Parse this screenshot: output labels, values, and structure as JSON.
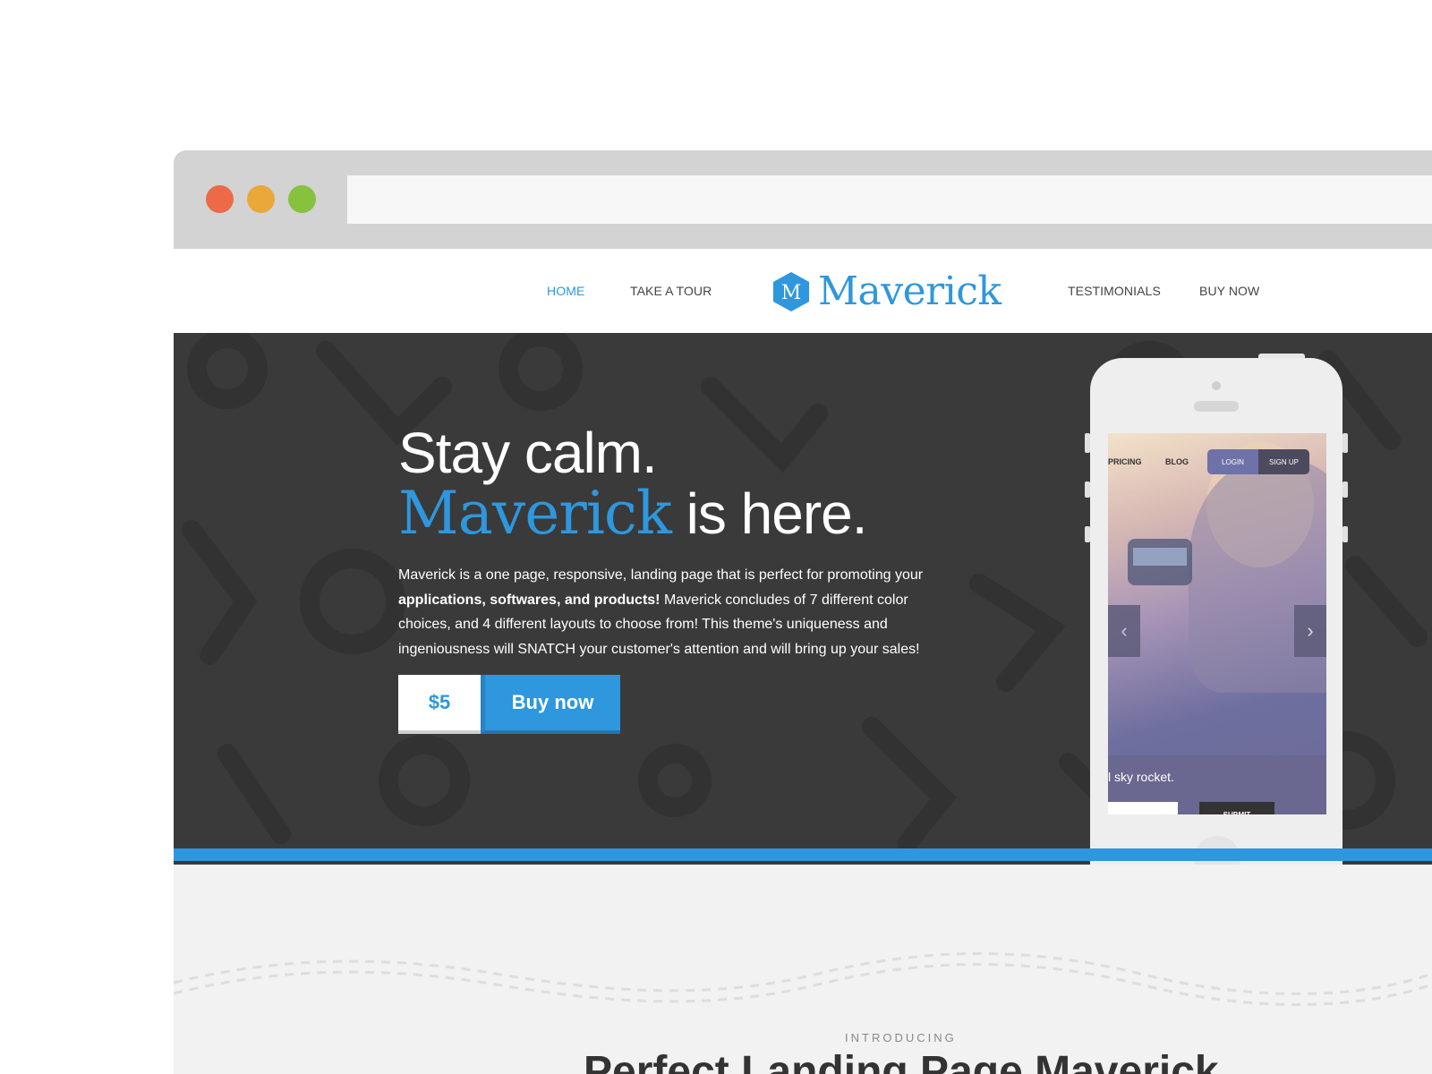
{
  "window": {
    "controls": [
      "close",
      "minimize",
      "maximize"
    ],
    "colors": {
      "close": "#ec6a47",
      "minimize": "#e9a83a",
      "maximize": "#86c23d"
    }
  },
  "nav": {
    "home": "HOME",
    "tour": "TAKE A TOUR",
    "testimonials": "TESTIMONIALS",
    "buy": "BUY NOW",
    "logo_letter": "M",
    "logo_text": "Maverick"
  },
  "hero": {
    "line1": "Stay calm.",
    "brand": "Maverick",
    "line2_rest": " is here.",
    "desc_part1": "Maverick is a one page, responsive, landing page that is perfect for promoting your ",
    "desc_bold": "applications, softwares, and products!",
    "desc_part2": " Maverick concludes of 7 different color choices, and 4 different layouts to choose from! This theme's uniqueness and ingeniousness will SNATCH your customer's attention and will bring up your sales!",
    "price": "$5",
    "buy_label": "Buy now",
    "accent_color": "#2e97dd"
  },
  "phone": {
    "pricing": "PRICING",
    "blog": "BLOG",
    "login": "LOGIN",
    "signup": "SIGN UP",
    "prev": "‹",
    "next": "›",
    "caption": "l sky rocket.",
    "submit": "SUBMIT"
  },
  "section": {
    "eyebrow": "INTRODUCING",
    "title": "Perfect Landing Page Maverick"
  }
}
